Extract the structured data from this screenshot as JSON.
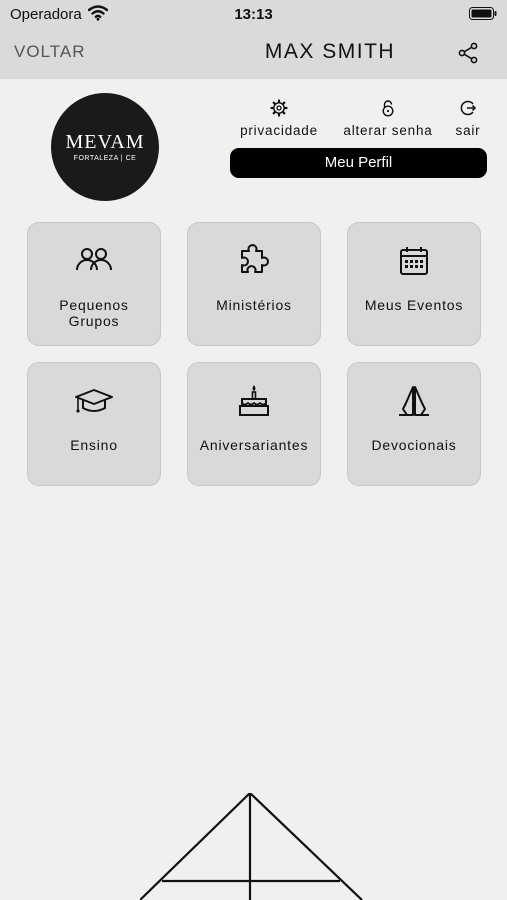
{
  "status_bar": {
    "carrier": "Operadora",
    "time": "13:13"
  },
  "nav": {
    "back_label": "VOLTAR",
    "title": "MAX SMITH"
  },
  "logo": {
    "line1": "MEVAM",
    "line2": "FORTALEZA | CE"
  },
  "header_links": [
    {
      "label": "privacidade",
      "icon": "gear-icon"
    },
    {
      "label": "alterar senha",
      "icon": "lock-icon"
    },
    {
      "label": "sair",
      "icon": "logout-icon"
    }
  ],
  "profile_button": "Meu Perfil",
  "tiles": [
    {
      "label": "Pequenos Grupos",
      "icon": "people-icon"
    },
    {
      "label": "Ministérios",
      "icon": "puzzle-icon"
    },
    {
      "label": "Meus Eventos",
      "icon": "calendar-icon"
    },
    {
      "label": "Ensino",
      "icon": "graduation-cap-icon"
    },
    {
      "label": "Aniversariantes",
      "icon": "birthday-cake-icon"
    },
    {
      "label": "Devocionais",
      "icon": "praying-hands-icon"
    }
  ]
}
